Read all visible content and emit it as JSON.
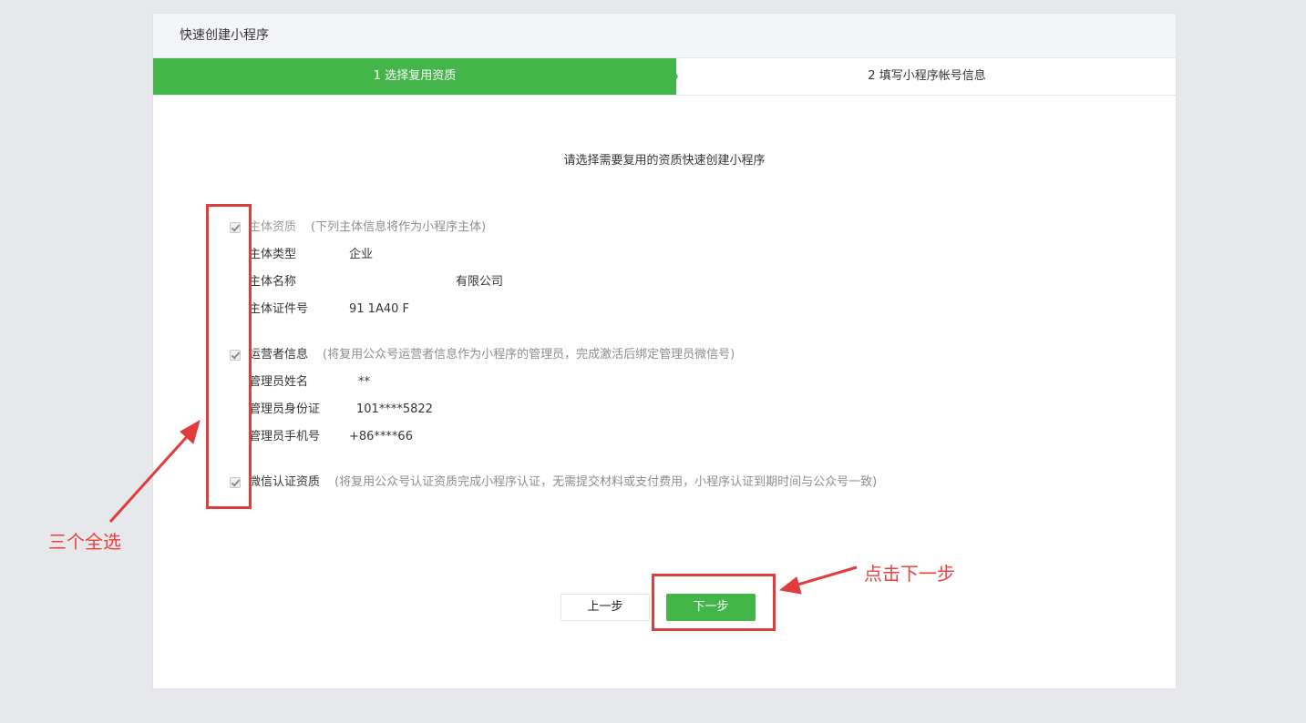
{
  "header": {
    "title": "快速创建小程序"
  },
  "steps": [
    {
      "label": "1 选择复用资质",
      "active": true
    },
    {
      "label": "2 填写小程序帐号信息",
      "active": false
    }
  ],
  "intro": "请选择需要复用的资质快速创建小程序",
  "sections": {
    "subject": {
      "title": "主体资质",
      "note": "(下列主体信息将作为小程序主体)",
      "rows": [
        {
          "label": "主体类型",
          "value": "企业"
        },
        {
          "label": "主体名称",
          "value": "有限公司"
        },
        {
          "label": "主体证件号",
          "value": "91    1A40    F"
        }
      ]
    },
    "operator": {
      "title": "运营者信息",
      "note": "(将复用公众号运营者信息作为小程序的管理员，完成激活后绑定管理员微信号)",
      "rows": [
        {
          "label": "管理员姓名",
          "value": "**"
        },
        {
          "label": "管理员身份证",
          "value": "101****5822"
        },
        {
          "label": "管理员手机号",
          "value": "+86****66"
        }
      ]
    },
    "wechat": {
      "title": "微信认证资质",
      "note": "(将复用公众号认证资质完成小程序认证，无需提交材料或支付费用，小程序认证到期时间与公众号一致)"
    }
  },
  "buttons": {
    "prev": "上一步",
    "next": "下一步"
  },
  "annotations": {
    "select_all": "三个全选",
    "click_next": "点击下一步"
  },
  "colors": {
    "accent": "#44b549",
    "annotation": "#e23b3b"
  }
}
